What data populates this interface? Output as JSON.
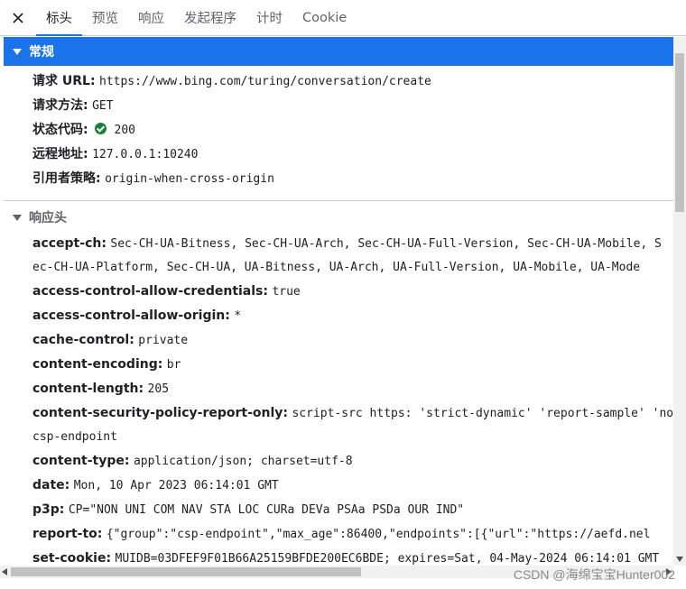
{
  "tabs": [
    {
      "label": "标头",
      "active": true
    },
    {
      "label": "预览",
      "active": false
    },
    {
      "label": "响应",
      "active": false
    },
    {
      "label": "发起程序",
      "active": false
    },
    {
      "label": "计时",
      "active": false
    },
    {
      "label": "Cookie",
      "active": false
    }
  ],
  "general": {
    "title": "常规",
    "request_url_key": "请求 URL:",
    "request_url": "https://www.bing.com/turing/conversation/create",
    "method_key": "请求方法:",
    "method": "GET",
    "status_key": "状态代码:",
    "status": "200",
    "remote_key": "远程地址:",
    "remote": "127.0.0.1:10240",
    "referrer_key": "引用者策略:",
    "referrer": "origin-when-cross-origin"
  },
  "response": {
    "title": "响应头",
    "accept_ch_key": "accept-ch:",
    "accept_ch_line1": "Sec-CH-UA-Bitness, Sec-CH-UA-Arch, Sec-CH-UA-Full-Version, Sec-CH-UA-Mobile, S",
    "accept_ch_line2": "ec-CH-UA-Platform, Sec-CH-UA, UA-Bitness, UA-Arch, UA-Full-Version, UA-Mobile, UA-Mode",
    "acac_key": "access-control-allow-credentials:",
    "acac": "true",
    "acao_key": "access-control-allow-origin:",
    "acao": "*",
    "cache_key": "cache-control:",
    "cache": "private",
    "encoding_key": "content-encoding:",
    "encoding": "br",
    "length_key": "content-length:",
    "length": "205",
    "csp_key": "content-security-policy-report-only:",
    "csp_line1": "script-src https: 'strict-dynamic' 'report-sample' 'non",
    "csp_line2": "csp-endpoint",
    "ctype_key": "content-type:",
    "ctype": "application/json; charset=utf-8",
    "date_key": "date:",
    "date": "Mon, 10 Apr 2023 06:14:01 GMT",
    "p3p_key": "p3p:",
    "p3p": "CP=\"NON UNI COM NAV STA LOC CURa DEVa PSAa PSDa OUR IND\"",
    "report_key": "report-to:",
    "report": "{\"group\":\"csp-endpoint\",\"max_age\":86400,\"endpoints\":[{\"url\":\"https://aefd.nel",
    "cookie_key": "set-cookie:",
    "cookie": "MUIDB=03DFEF9F01B66A25159BFDE200EC6BDE; expires=Sat, 04-May-2024 06:14:01 GMT"
  },
  "watermark": "CSDN @海绵宝宝Hunter002",
  "colors": {
    "accent": "#1a73e8",
    "status_ok": "#188038"
  }
}
